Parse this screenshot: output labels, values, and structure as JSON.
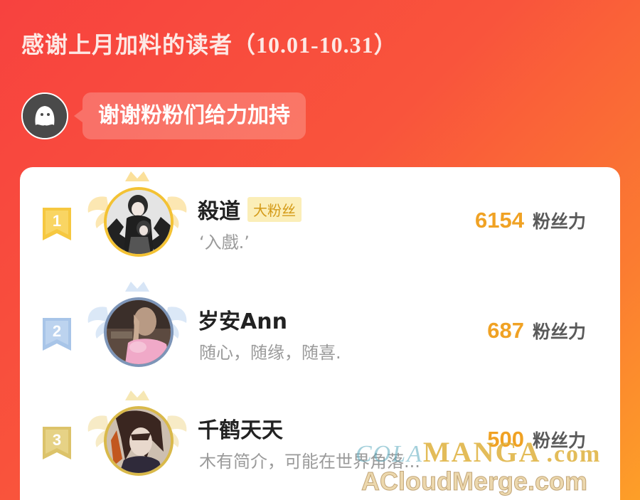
{
  "header": {
    "title": "感谢上月加料的读者（",
    "range": "10.01-10.31",
    "close_paren": "）"
  },
  "host": {
    "bubble_text": "谢谢粉粉们给力加持"
  },
  "leaderboard": {
    "unit_label": "粉丝力",
    "entries": [
      {
        "rank": "1",
        "name": "殺道",
        "tag": "大粉丝",
        "bio": "‘入戲.’",
        "score": "6154",
        "color": "#f5c83a"
      },
      {
        "rank": "2",
        "name": "岁安Ann",
        "tag": "",
        "bio": "随心，随缘，随喜.",
        "score": "687",
        "color": "#a9c6e6"
      },
      {
        "rank": "3",
        "name": "千鹤天天",
        "tag": "",
        "bio": "木有简介，可能在世界角落...",
        "score": "500",
        "color": "#dcc46a"
      }
    ]
  },
  "watermark": {
    "top_left": "COLA",
    "top_main": "MANGA",
    "top_suffix": ".com",
    "bottom": "ACloudMerge.com"
  }
}
